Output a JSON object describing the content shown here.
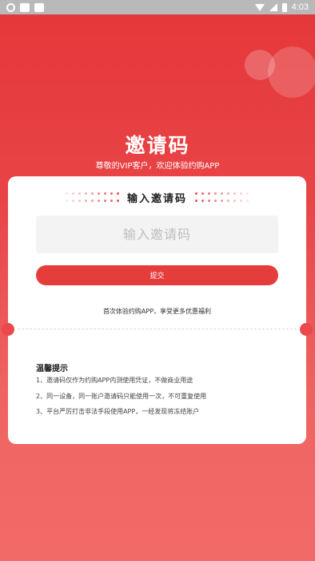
{
  "status_bar": {
    "time": "4:03",
    "left_icons": [
      "notification-icon",
      "app-icon",
      "image-icon"
    ],
    "right_icons": [
      "wifi-icon",
      "signal-icon",
      "battery-icon"
    ]
  },
  "header": {
    "title": "邀请码",
    "subtitle": "尊敬的VIP客户，欢迎体验约购APP"
  },
  "card": {
    "heading": "输入邀请码",
    "input_placeholder": "输入邀请码",
    "submit_label": "提交",
    "note": "首次体验约购APP，享受更多优惠福利"
  },
  "tips": {
    "title": "温馨提示",
    "items": [
      "1、邀请码仅作为约购APP内测使用凭证，不做商业用途",
      "2、同一设备，同一账户邀请码只能使用一次，不可重复使用",
      "3、平台严厉打击非法手段使用APP，一经发现将冻结账户"
    ]
  },
  "colors": {
    "brand_red": "#e53c3c",
    "background_top": "#e5373a",
    "background_bottom": "#f26a68"
  }
}
